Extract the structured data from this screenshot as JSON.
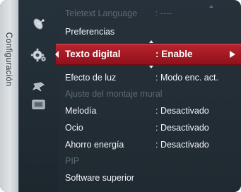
{
  "sidebar": {
    "label": "Configuración"
  },
  "icons": [
    "satellite-dish-icon",
    "gear-icon",
    "star-icon",
    "input-icon"
  ],
  "menu": [
    {
      "label": "Teletext Language",
      "value": ": ----",
      "enabled": false
    },
    {
      "label": "Preferencias",
      "value": "",
      "enabled": true
    },
    {
      "label": "Texto digital",
      "value": ": Enable",
      "enabled": true,
      "selected": true
    },
    {
      "label": "Efecto de luz",
      "value": ": Modo enc. act.",
      "enabled": true
    },
    {
      "label": "Ajuste del montaje mural",
      "value": "",
      "enabled": false
    },
    {
      "label": "Melodía",
      "value": ": Desactivado",
      "enabled": true
    },
    {
      "label": "Ocio",
      "value": ": Desactivado",
      "enabled": true
    },
    {
      "label": "Ahorro energía",
      "value": ": Desactivado",
      "enabled": true
    },
    {
      "label": "PIP",
      "value": "",
      "enabled": false
    },
    {
      "label": "Software superior",
      "value": "",
      "enabled": true
    }
  ],
  "colors": {
    "highlight": "#a21822",
    "panel": "#222c33",
    "disabled_text": "#5d6a73",
    "tab": "#d6dbde"
  }
}
